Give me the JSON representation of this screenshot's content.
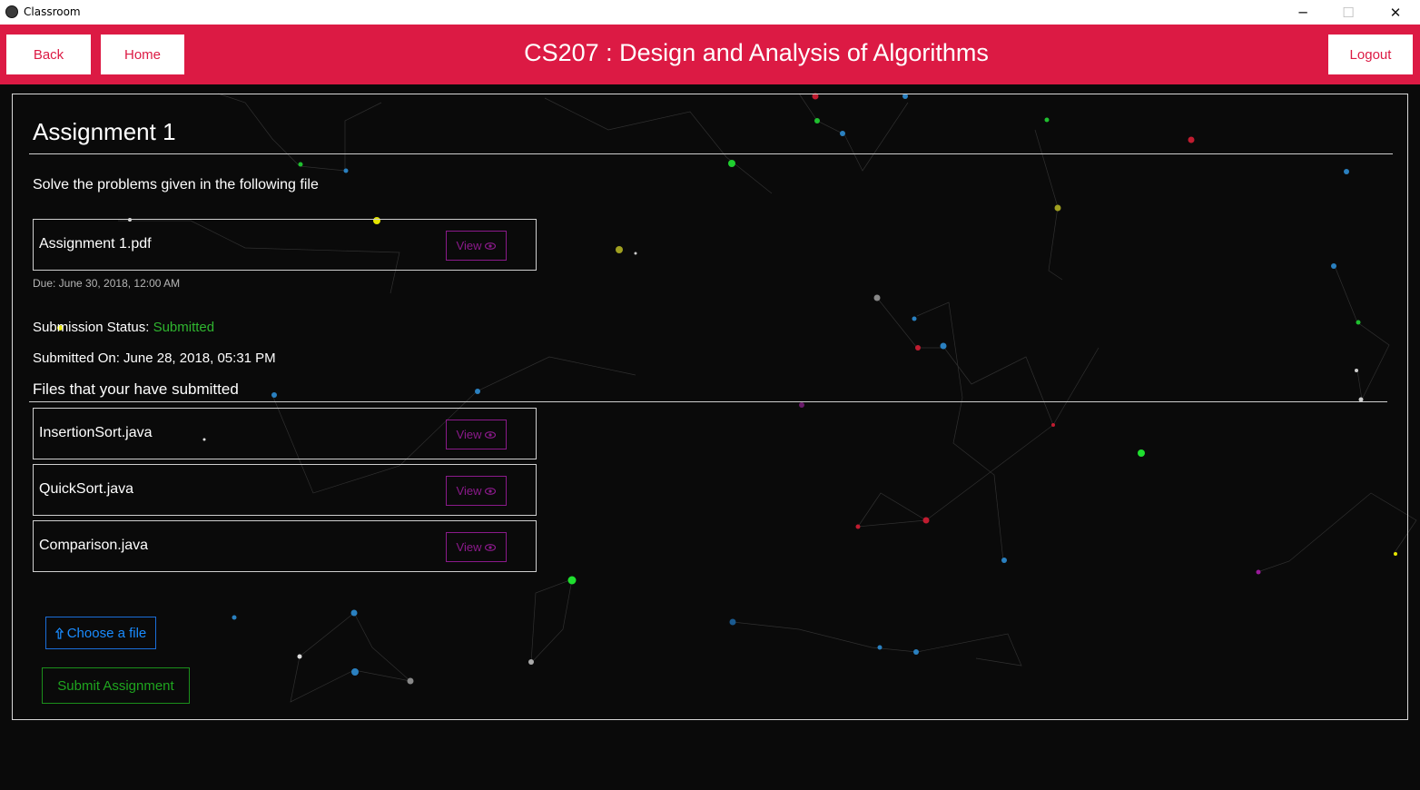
{
  "window": {
    "title": "Classroom",
    "minimize_glyph": "─",
    "maximize_glyph": "☐",
    "close_glyph": "✕"
  },
  "nav": {
    "back_label": "Back",
    "home_label": "Home",
    "course_title": "CS207 : Design and Analysis of Algorithms",
    "logout_label": "Logout"
  },
  "assignment": {
    "title": "Assignment 1",
    "description": "Solve the problems given in the following file",
    "file": {
      "name": "Assignment 1.pdf",
      "view_label": "View"
    },
    "due": "Due: June 30, 2018, 12:00 AM",
    "status_label": "Submission Status:",
    "status_value": "Submitted",
    "submitted_on": "Submitted On: June 28, 2018, 05:31 PM",
    "files_heading": "Files that your have submitted",
    "submitted_files": [
      {
        "name": "InsertionSort.java",
        "view_label": "View"
      },
      {
        "name": "QuickSort.java",
        "view_label": "View"
      },
      {
        "name": "Comparison.java",
        "view_label": "View"
      }
    ],
    "choose_file_label": "Choose a file",
    "submit_label": "Submit Assignment"
  },
  "icons": {
    "view": "eye-icon",
    "choose_file": "upload-icon",
    "app": "app-logo-icon"
  },
  "colors": {
    "accent": "#dc1a44",
    "background": "#0a0a0a",
    "status_submitted": "#2fb52f",
    "view_button": "#8b1a8b",
    "choose_file": "#1a8cff",
    "submit": "#1fa51f"
  }
}
